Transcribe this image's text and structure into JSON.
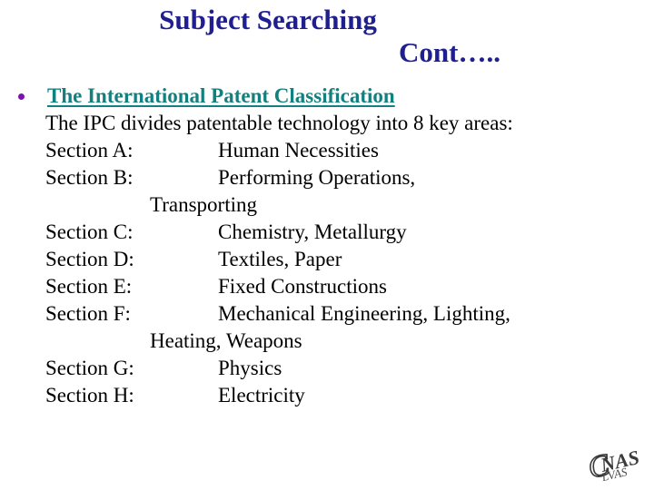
{
  "slide": {
    "title_line_1": "Subject Searching",
    "title_line_2": "Cont…..",
    "title_color": "#1f1f8f",
    "background_color": "#ffffff"
  },
  "body": {
    "bullet_glyph": "•",
    "bullet_color": "#8010b0",
    "heading": "The International Patent Classification",
    "heading_color": "#12807e",
    "intro": "The IPC divides patentable technology into 8 key areas:",
    "sections": [
      {
        "label": "Section A:",
        "value": "Human Necessities",
        "wrap": null
      },
      {
        "label": "Section B:",
        "value": "Performing Operations,",
        "wrap": "Transporting"
      },
      {
        "label": "Section C:",
        "value": "Chemistry, Metallurgy",
        "wrap": null
      },
      {
        "label": "Section D:",
        "value": "Textiles, Paper",
        "wrap": null
      },
      {
        "label": "Section E:",
        "value": "Fixed Constructions",
        "wrap": null
      },
      {
        "label": "Section F:",
        "value": "Mechanical Engineering, Lighting,",
        "wrap": "Heating, Weapons"
      },
      {
        "label": "Section G:",
        "value": "Physics",
        "wrap": null
      },
      {
        "label": "Section H:",
        "value": "Electricity",
        "wrap": null
      }
    ]
  },
  "watermark": {
    "text": "CNAS",
    "color": "#2b2b2b"
  }
}
